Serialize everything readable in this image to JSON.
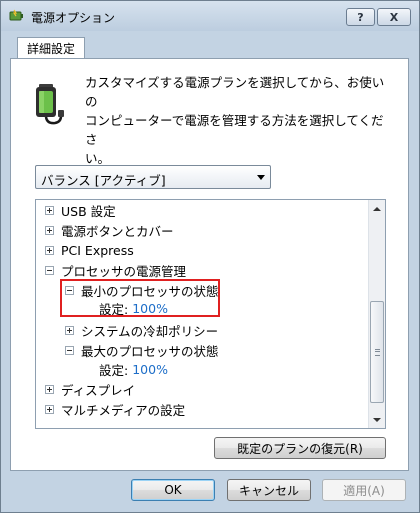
{
  "window": {
    "title": "電源オプション",
    "help_label": "?",
    "close_label": "X"
  },
  "tabs": [
    {
      "label": "詳細設定"
    }
  ],
  "description": {
    "line1": "カスタマイズする電源プランを選択してから、お使いの",
    "line2": "コンピューターで電源を管理する方法を選択してくださ",
    "line3": "い。"
  },
  "plan_select": {
    "value": "バランス [アクティブ]"
  },
  "tree": {
    "items": [
      {
        "label": "USB 設定",
        "state": "collapsed"
      },
      {
        "label": "電源ボタンとカバー",
        "state": "collapsed"
      },
      {
        "label": "PCI Express",
        "state": "collapsed"
      },
      {
        "label": "プロセッサの電源管理",
        "state": "expanded"
      },
      {
        "label": "最小のプロセッサの状態",
        "state": "expanded",
        "setting_label": "設定:",
        "setting_value": "100%"
      },
      {
        "label": "システムの冷却ポリシー",
        "state": "collapsed"
      },
      {
        "label": "最大のプロセッサの状態",
        "state": "expanded",
        "setting_label": "設定:",
        "setting_value": "100%"
      },
      {
        "label": "ディスプレイ",
        "state": "collapsed"
      },
      {
        "label": "マルチメディアの設定",
        "state": "collapsed"
      }
    ]
  },
  "buttons": {
    "restore": "既定のプランの復元(R)",
    "ok": "OK",
    "cancel": "キャンセル",
    "apply": "適用(A)"
  },
  "colors": {
    "highlight_border": "#e02020",
    "setting_value": "#1e6ec8"
  },
  "icons": [
    "power-options-icon",
    "battery-plug-icon",
    "chevron-down-icon",
    "scroll-up-icon",
    "scroll-down-icon"
  ]
}
